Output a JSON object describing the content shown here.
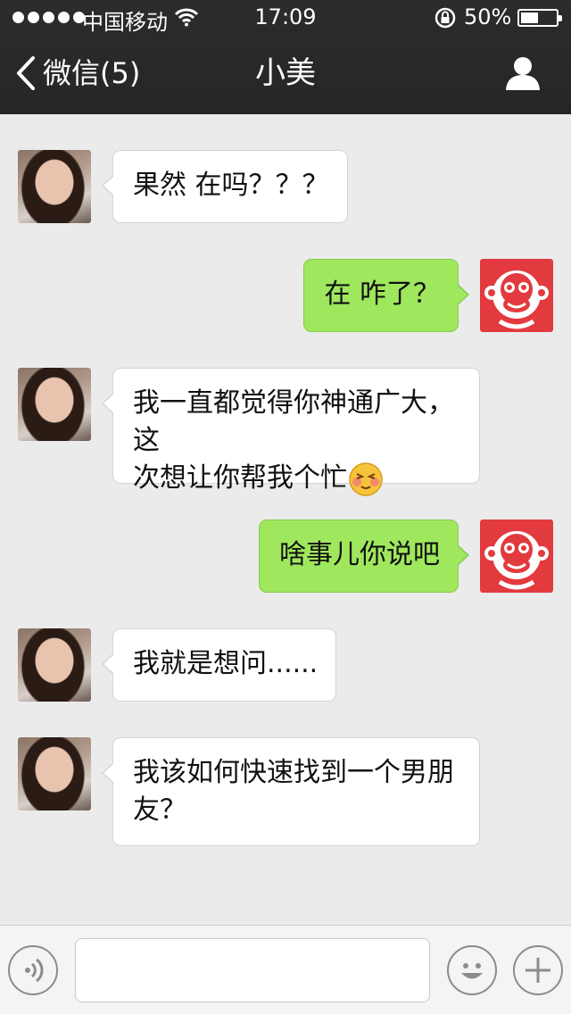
{
  "status_bar": {
    "carrier": "中国移动",
    "time": "17:09",
    "battery_percent": "50%",
    "battery_level": 0.5
  },
  "nav": {
    "back_label": "微信(5)",
    "title": "小美"
  },
  "messages": [
    {
      "from": "other",
      "text": "果然 在吗？？？"
    },
    {
      "from": "me",
      "text": "在 咋了？"
    },
    {
      "from": "other",
      "line1": "我一直都觉得你神通广大，这",
      "line2": "次想让你帮我个忙",
      "emoji": "blushing-face-emoji"
    },
    {
      "from": "me",
      "text": "啥事儿你说吧"
    },
    {
      "from": "other",
      "text": "我就是想问......"
    },
    {
      "from": "other",
      "line1": "我该如何快速找到一个男朋",
      "line2": "友？"
    }
  ],
  "input_bar": {
    "value": "",
    "icons": [
      "voice-icon",
      "emoji-icon",
      "plus-icon"
    ]
  },
  "colors": {
    "nav_bg": "#272729",
    "chat_bg": "#ebebeb",
    "bubble_out": "#9fe85d",
    "bubble_in": "#ffffff",
    "monkey_avatar_bg": "#e23a3e"
  }
}
